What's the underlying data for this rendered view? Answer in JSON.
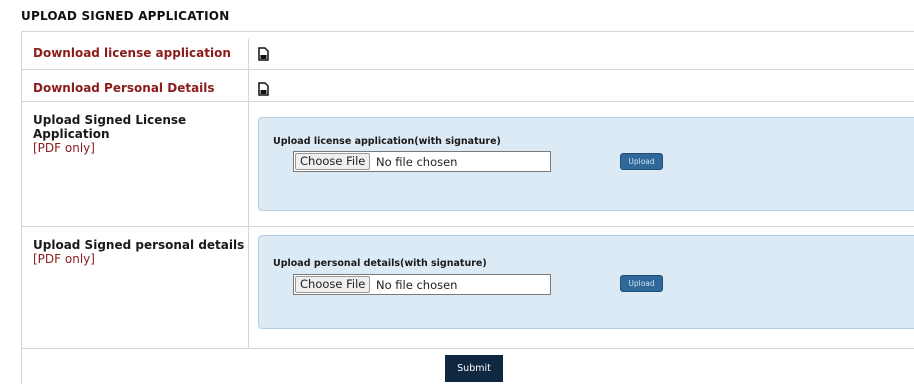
{
  "page": {
    "title": "UPLOAD SIGNED APPLICATION"
  },
  "downloads": [
    {
      "label": "Download license application",
      "icon": "document-icon"
    },
    {
      "label": "Download Personal Details",
      "icon": "document-icon"
    }
  ],
  "uploads": [
    {
      "title": "Upload Signed License Application",
      "note": "[PDF only]",
      "panel_label": "Upload license application(with signature)",
      "choose_label": "Choose File",
      "file_status": "No file chosen",
      "upload_label": "Upload"
    },
    {
      "title": "Upload Signed personal details",
      "note": "[PDF only]",
      "panel_label": "Upload personal details(with signature)",
      "choose_label": "Choose File",
      "file_status": "No file chosen",
      "upload_label": "Upload"
    }
  ],
  "submit_label": "Submit",
  "colors": {
    "label_red": "#8b1c1c",
    "panel_bg": "#dceaf6",
    "upload_btn": "#2f6899",
    "submit_bg": "#0f2740"
  }
}
